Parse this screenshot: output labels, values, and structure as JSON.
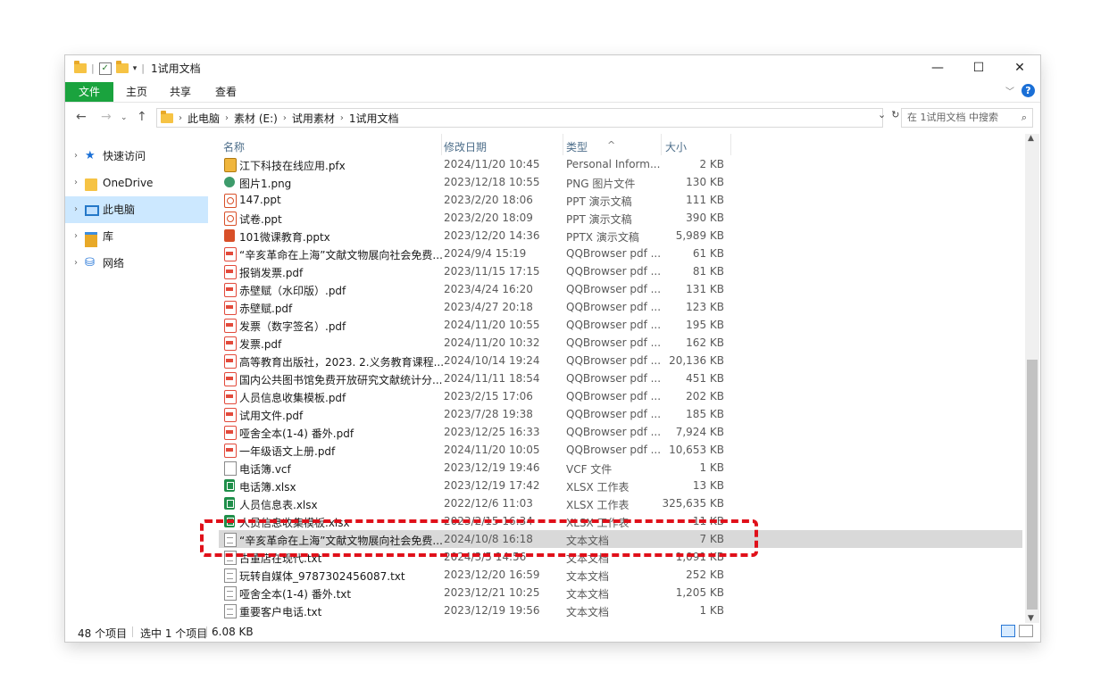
{
  "window": {
    "title": "1试用文档",
    "controls": {
      "minimize": "—",
      "maximize": "☐",
      "close": "✕"
    }
  },
  "ribbon": {
    "tabs": [
      "文件",
      "主页",
      "共享",
      "查看"
    ]
  },
  "address": {
    "breadcrumbs": [
      "此电脑",
      "素材 (E:)",
      "试用素材",
      "1试用文档"
    ],
    "search_placeholder": "在 1试用文档 中搜索"
  },
  "navpane": {
    "items": [
      {
        "label": "快速访问",
        "icon": "star-icon"
      },
      {
        "label": "OneDrive",
        "icon": "folder-icon"
      },
      {
        "label": "此电脑",
        "icon": "computer-icon",
        "selected": true
      },
      {
        "label": "库",
        "icon": "library-icon"
      },
      {
        "label": "网络",
        "icon": "network-icon"
      }
    ]
  },
  "columns": {
    "name": "名称",
    "date": "修改日期",
    "type": "类型",
    "size": "大小"
  },
  "files": [
    {
      "name": "江下科技在线应用.pfx",
      "date": "2024/11/20 10:45",
      "type": "Personal Inform...",
      "size": "2 KB",
      "icon": "pfx"
    },
    {
      "name": "图片1.png",
      "date": "2023/12/18 10:55",
      "type": "PNG 图片文件",
      "size": "130 KB",
      "icon": "png"
    },
    {
      "name": "147.ppt",
      "date": "2023/2/20 18:06",
      "type": "PPT 演示文稿",
      "size": "111 KB",
      "icon": "ppt"
    },
    {
      "name": "试卷.ppt",
      "date": "2023/2/20 18:09",
      "type": "PPT 演示文稿",
      "size": "390 KB",
      "icon": "ppt"
    },
    {
      "name": "101微课教育.pptx",
      "date": "2023/12/20 14:36",
      "type": "PPTX 演示文稿",
      "size": "5,989 KB",
      "icon": "pptx"
    },
    {
      "name": "“辛亥革命在上海”文献文物展向社会免费...",
      "date": "2024/9/4 15:19",
      "type": "QQBrowser pdf ...",
      "size": "61 KB",
      "icon": "pdf"
    },
    {
      "name": "报销发票.pdf",
      "date": "2023/11/15 17:15",
      "type": "QQBrowser pdf ...",
      "size": "81 KB",
      "icon": "pdf"
    },
    {
      "name": "赤壁赋（水印版）.pdf",
      "date": "2023/4/24 16:20",
      "type": "QQBrowser pdf ...",
      "size": "131 KB",
      "icon": "pdf"
    },
    {
      "name": "赤壁赋.pdf",
      "date": "2023/4/27 20:18",
      "type": "QQBrowser pdf ...",
      "size": "123 KB",
      "icon": "pdf"
    },
    {
      "name": "发票（数字签名）.pdf",
      "date": "2024/11/20 10:55",
      "type": "QQBrowser pdf ...",
      "size": "195 KB",
      "icon": "pdf"
    },
    {
      "name": "发票.pdf",
      "date": "2024/11/20 10:32",
      "type": "QQBrowser pdf ...",
      "size": "162 KB",
      "icon": "pdf"
    },
    {
      "name": "高等教育出版社，2023. 2.义务教育课程...",
      "date": "2024/10/14 19:24",
      "type": "QQBrowser pdf ...",
      "size": "20,136 KB",
      "icon": "pdf"
    },
    {
      "name": "国内公共图书馆免费开放研究文献统计分...",
      "date": "2024/11/11 18:54",
      "type": "QQBrowser pdf ...",
      "size": "451 KB",
      "icon": "pdf"
    },
    {
      "name": "人员信息收集模板.pdf",
      "date": "2023/2/15 17:06",
      "type": "QQBrowser pdf ...",
      "size": "202 KB",
      "icon": "pdf"
    },
    {
      "name": "试用文件.pdf",
      "date": "2023/7/28 19:38",
      "type": "QQBrowser pdf ...",
      "size": "185 KB",
      "icon": "pdf"
    },
    {
      "name": "哑舍全本(1-4) 番外.pdf",
      "date": "2023/12/25 16:33",
      "type": "QQBrowser pdf ...",
      "size": "7,924 KB",
      "icon": "pdf"
    },
    {
      "name": "一年级语文上册.pdf",
      "date": "2024/11/20 10:05",
      "type": "QQBrowser pdf ...",
      "size": "10,653 KB",
      "icon": "pdf"
    },
    {
      "name": "电话簿.vcf",
      "date": "2023/12/19 19:46",
      "type": "VCF 文件",
      "size": "1 KB",
      "icon": "vcf"
    },
    {
      "name": "电话簿.xlsx",
      "date": "2023/12/19 17:42",
      "type": "XLSX 工作表",
      "size": "13 KB",
      "icon": "xlsx"
    },
    {
      "name": "人员信息表.xlsx",
      "date": "2022/12/6 11:03",
      "type": "XLSX 工作表",
      "size": "325,635 KB",
      "icon": "xlsx"
    },
    {
      "name": "人员信息收集模板.xlsx",
      "date": "2023/2/15 16:34",
      "type": "XLSX 工作表",
      "size": "11 KB",
      "icon": "xlsx"
    },
    {
      "name": "“辛亥革命在上海”文献文物展向社会免费...",
      "date": "2024/10/8 16:18",
      "type": "文本文档",
      "size": "7 KB",
      "icon": "txt",
      "selected": true
    },
    {
      "name": "古董店在现代.txt",
      "date": "2024/3/5 14:56",
      "type": "文本文档",
      "size": "1,091 KB",
      "icon": "txt"
    },
    {
      "name": "玩转自媒体_9787302456087.txt",
      "date": "2023/12/20 16:59",
      "type": "文本文档",
      "size": "252 KB",
      "icon": "txt"
    },
    {
      "name": "哑舍全本(1-4) 番外.txt",
      "date": "2023/12/21 10:25",
      "type": "文本文档",
      "size": "1,205 KB",
      "icon": "txt"
    },
    {
      "name": "重要客户电话.txt",
      "date": "2023/12/19 19:56",
      "type": "文本文档",
      "size": "1 KB",
      "icon": "txt"
    }
  ],
  "status": {
    "count": "48 个项目",
    "selected": "选中 1 个项目",
    "size": "6.08 KB"
  },
  "colors": {
    "file_tab": "#1aa33e",
    "selection": "#cce8ff",
    "annotation": "#e0101a"
  }
}
